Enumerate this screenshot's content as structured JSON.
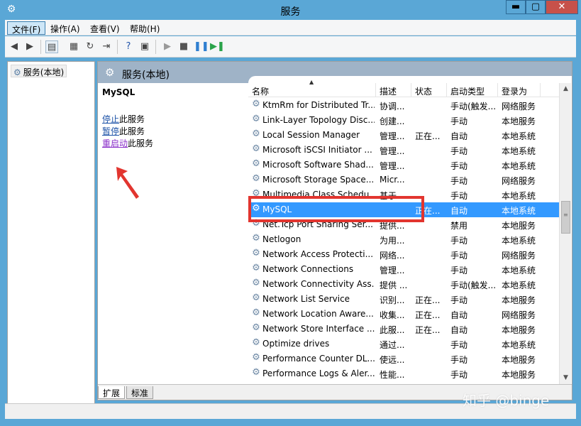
{
  "window": {
    "title": "服务",
    "min": "▬",
    "max": "▢",
    "close": "✕"
  },
  "menu": [
    "文件(F)",
    "操作(A)",
    "查看(V)",
    "帮助(H)"
  ],
  "tree": {
    "root": "服务(本地)"
  },
  "pane": {
    "title": "服务(本地)",
    "selected_service": "MySQL",
    "actions": [
      {
        "link": "停止",
        "suffix": "此服务"
      },
      {
        "link": "暂停",
        "suffix": "此服务"
      },
      {
        "link": "重启动",
        "suffix": "此服务"
      }
    ]
  },
  "columns": [
    "名称",
    "描述",
    "状态",
    "启动类型",
    "登录为"
  ],
  "rows": [
    {
      "name": "KtmRm for Distributed Tr...",
      "desc": "协调...",
      "status": "",
      "startup": "手动(触发...",
      "logon": "网络服务"
    },
    {
      "name": "Link-Layer Topology Disc...",
      "desc": "创建...",
      "status": "",
      "startup": "手动",
      "logon": "本地服务"
    },
    {
      "name": "Local Session Manager",
      "desc": "管理...",
      "status": "正在...",
      "startup": "自动",
      "logon": "本地系统"
    },
    {
      "name": "Microsoft iSCSI Initiator ...",
      "desc": "管理...",
      "status": "",
      "startup": "手动",
      "logon": "本地系统"
    },
    {
      "name": "Microsoft Software Shad...",
      "desc": "管理...",
      "status": "",
      "startup": "手动",
      "logon": "本地系统"
    },
    {
      "name": "Microsoft Storage Space...",
      "desc": "Micr...",
      "status": "",
      "startup": "手动",
      "logon": "网络服务"
    },
    {
      "name": "Multimedia Class Schedu...",
      "desc": "基于...",
      "status": "",
      "startup": "手动",
      "logon": "本地系统"
    },
    {
      "name": "MySQL",
      "desc": "",
      "status": "正在...",
      "startup": "自动",
      "logon": "本地系统",
      "selected": true
    },
    {
      "name": "Net.Tcp Port Sharing Ser...",
      "desc": "提供...",
      "status": "",
      "startup": "禁用",
      "logon": "本地服务"
    },
    {
      "name": "Netlogon",
      "desc": "为用...",
      "status": "",
      "startup": "手动",
      "logon": "本地系统"
    },
    {
      "name": "Network Access Protecti...",
      "desc": "网络...",
      "status": "",
      "startup": "手动",
      "logon": "网络服务"
    },
    {
      "name": "Network Connections",
      "desc": "管理...",
      "status": "",
      "startup": "手动",
      "logon": "本地系统"
    },
    {
      "name": "Network Connectivity Ass...",
      "desc": "提供 ...",
      "status": "",
      "startup": "手动(触发...",
      "logon": "本地系统"
    },
    {
      "name": "Network List Service",
      "desc": "识别...",
      "status": "正在...",
      "startup": "手动",
      "logon": "本地服务"
    },
    {
      "name": "Network Location Aware...",
      "desc": "收集...",
      "status": "正在...",
      "startup": "自动",
      "logon": "网络服务"
    },
    {
      "name": "Network Store Interface ...",
      "desc": "此服...",
      "status": "正在...",
      "startup": "自动",
      "logon": "本地服务"
    },
    {
      "name": "Optimize drives",
      "desc": "通过...",
      "status": "",
      "startup": "手动",
      "logon": "本地系统"
    },
    {
      "name": "Performance Counter DL...",
      "desc": "使远...",
      "status": "",
      "startup": "手动",
      "logon": "本地服务"
    },
    {
      "name": "Performance Logs & Aler...",
      "desc": "性能...",
      "status": "",
      "startup": "手动",
      "logon": "本地服务"
    }
  ],
  "tabs": [
    "扩展",
    "标准"
  ],
  "watermark": "知乎 @binge",
  "colors": {
    "title_bar": "#5aa7d6",
    "selection": "#3399ff",
    "highlight_box": "#e2352f",
    "arrow": "#e2352f"
  }
}
